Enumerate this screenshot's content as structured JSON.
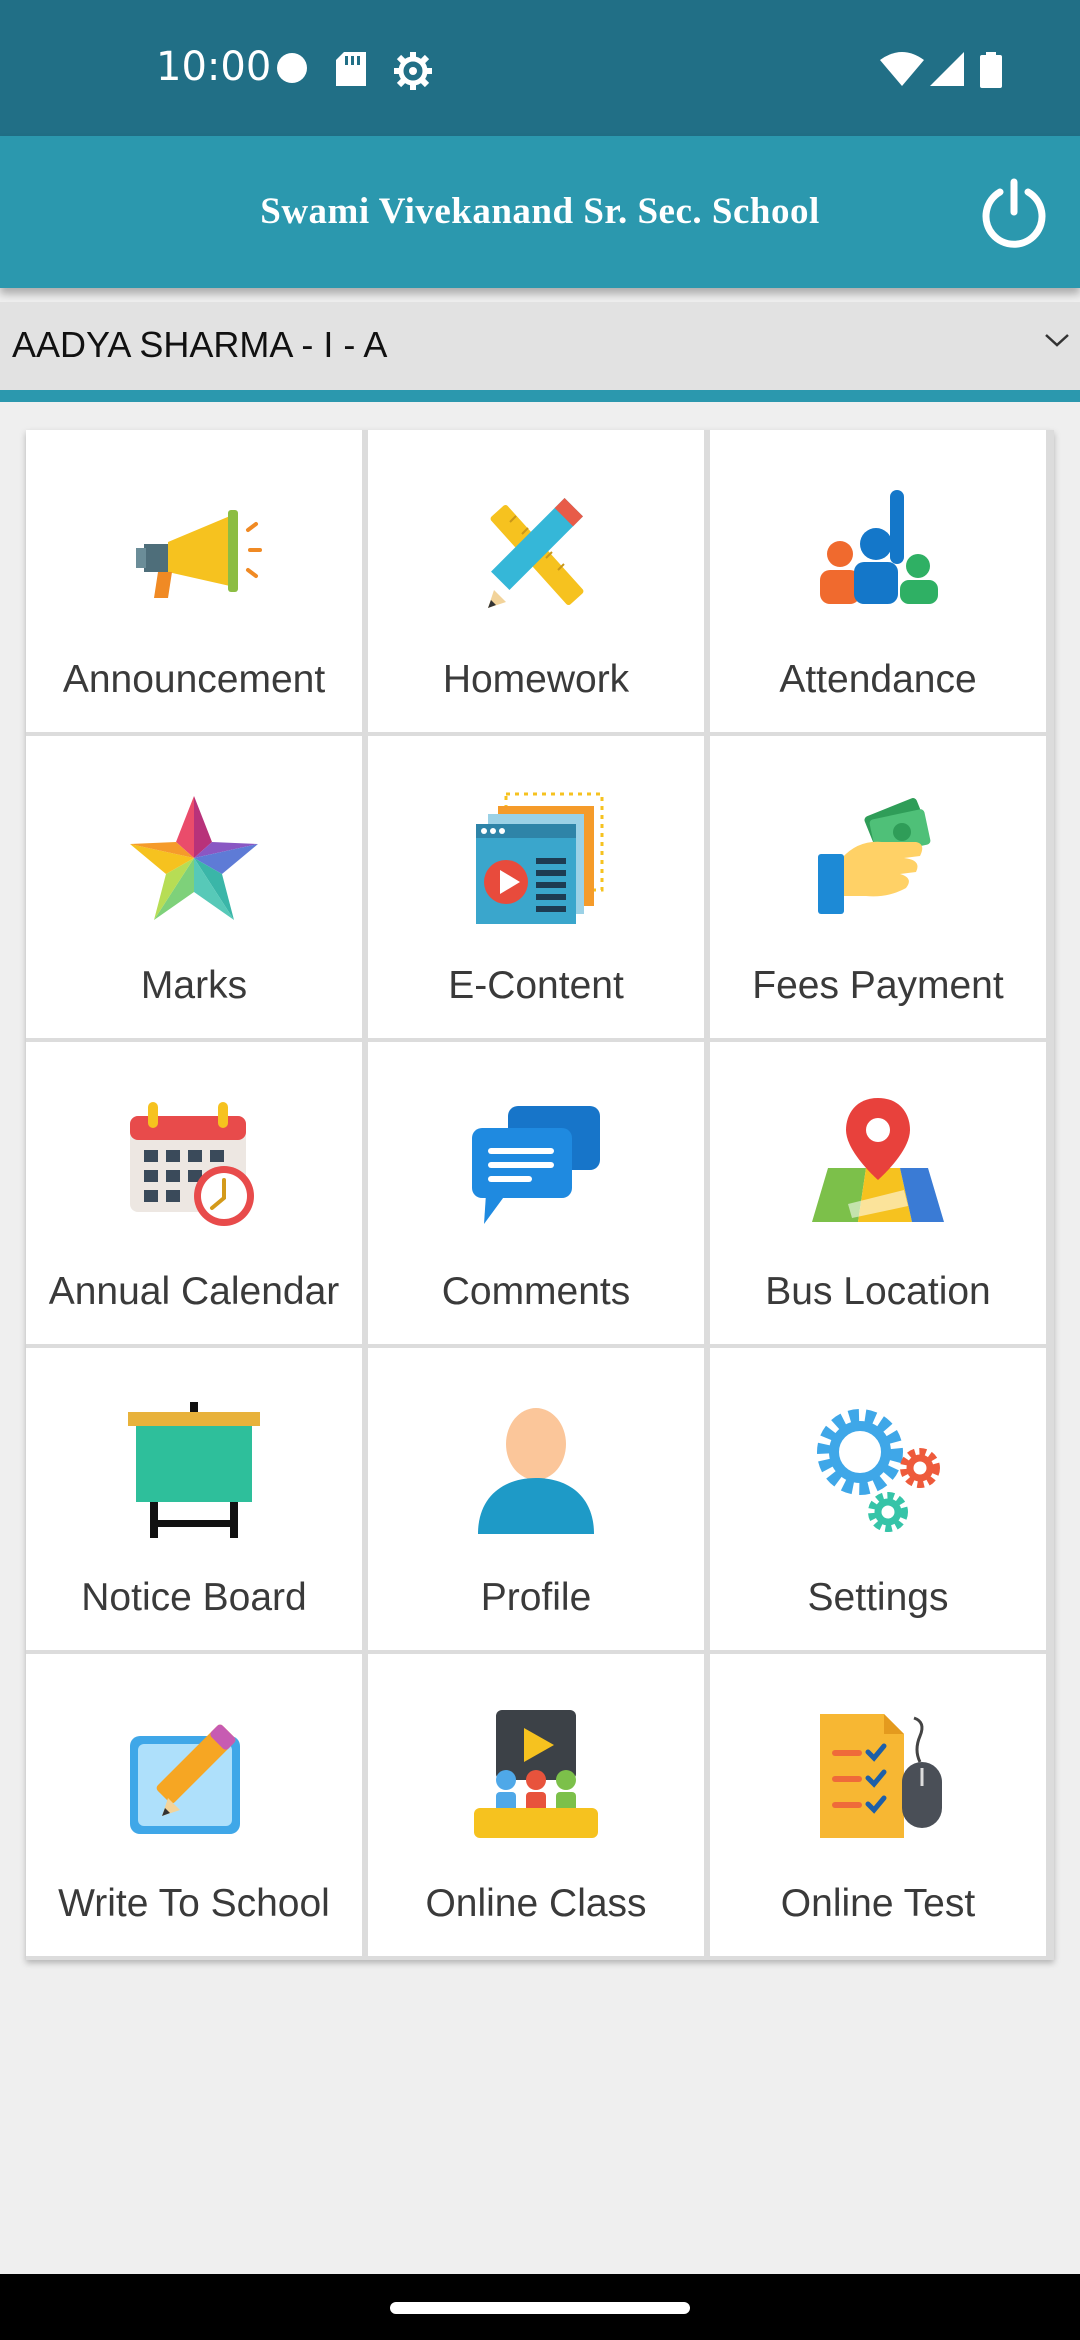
{
  "status_bar": {
    "time": "10:00",
    "left_icons": [
      "dot-icon",
      "sd-card-icon",
      "settings-gear-icon"
    ],
    "right_icons": [
      "wifi-icon",
      "cell-signal-icon",
      "battery-icon"
    ]
  },
  "app_bar": {
    "title": "Swami Vivekanand Sr. Sec. School",
    "logout_icon": "power-icon",
    "color": "#2b98ae"
  },
  "student_selector": {
    "selected": "AADYA SHARMA - I - A",
    "icon": "chevron-down-icon"
  },
  "menu": [
    {
      "label": "Announcement",
      "icon": "megaphone-icon"
    },
    {
      "label": "Homework",
      "icon": "pencil-ruler-icon"
    },
    {
      "label": "Attendance",
      "icon": "raised-hand-people-icon"
    },
    {
      "label": "Marks",
      "icon": "star-icon"
    },
    {
      "label": "E-Content",
      "icon": "media-window-icon"
    },
    {
      "label": "Fees Payment",
      "icon": "hand-money-icon"
    },
    {
      "label": "Annual Calendar",
      "icon": "calendar-clock-icon"
    },
    {
      "label": "Comments",
      "icon": "chat-bubbles-icon"
    },
    {
      "label": "Bus Location",
      "icon": "map-pin-icon"
    },
    {
      "label": "Notice Board",
      "icon": "easel-board-icon"
    },
    {
      "label": "Profile",
      "icon": "user-avatar-icon"
    },
    {
      "label": "Settings",
      "icon": "gears-icon"
    },
    {
      "label": "Write To School",
      "icon": "write-note-icon"
    },
    {
      "label": "Online Class",
      "icon": "video-class-icon"
    },
    {
      "label": "Online Test",
      "icon": "checklist-mouse-icon"
    }
  ]
}
